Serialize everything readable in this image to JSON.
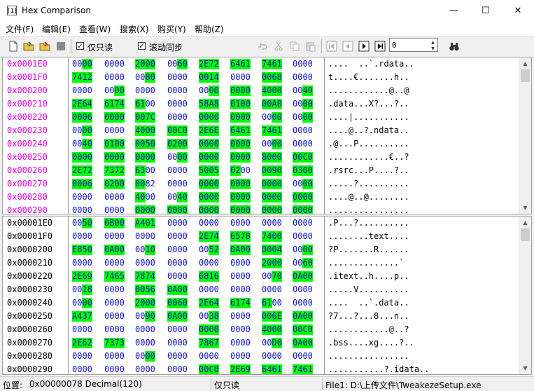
{
  "window": {
    "title": "Hex Comparison",
    "icon": "[1]",
    "minimize": "—",
    "maximize": "☐",
    "close": "✕"
  },
  "menu": [
    "文件(F)",
    "编辑(E)",
    "查看(W)",
    "搜索(X)",
    "购买(Y)",
    "帮助(Z)"
  ],
  "toolbar": {
    "readonly_label": "仅只读",
    "sync_scroll_label": "滚动同步",
    "offset_value": "0",
    "readonly_checked": "✓",
    "sync_checked": "✓"
  },
  "pane1": {
    "addresses": [
      "0x0001E0",
      "0x0001F0",
      "0x000200",
      "0x000210",
      "0x000220",
      "0x000230",
      "0x000240",
      "0x000250",
      "0x000260",
      "0x000270",
      "0x000280",
      "0x000290"
    ],
    "hex": [
      [
        "0000",
        "0000",
        "2000",
        "0060",
        "2E72",
        "6461",
        "7461",
        "0000"
      ],
      [
        "7412",
        "0000",
        "0080",
        "0000",
        "0014",
        "0000",
        "0068",
        "0000"
      ],
      [
        "0000",
        "0000",
        "0000",
        "0000",
        "0000",
        "0000",
        "4000",
        "0040"
      ],
      [
        "2E64",
        "6174",
        "6100",
        "0000",
        "58A8",
        "0100",
        "00A0",
        "0000"
      ],
      [
        "0006",
        "0000",
        "007C",
        "0000",
        "0000",
        "0000",
        "0000",
        "0000"
      ],
      [
        "0000",
        "0000",
        "4000",
        "00C0",
        "2E6E",
        "6461",
        "7461",
        "0000"
      ],
      [
        "0040",
        "0100",
        "0050",
        "0200",
        "0000",
        "0000",
        "0000",
        "0000"
      ],
      [
        "0000",
        "0000",
        "0000",
        "0000",
        "0000",
        "0000",
        "8000",
        "00C0"
      ],
      [
        "2E72",
        "7372",
        "6300",
        "0000",
        "5005",
        "0200",
        "0090",
        "0300"
      ],
      [
        "0006",
        "0200",
        "0082",
        "0000",
        "0000",
        "0000",
        "0000",
        "0000"
      ],
      [
        "0000",
        "0000",
        "4000",
        "0040",
        "0000",
        "0000",
        "0000",
        "0000"
      ],
      [
        "0000",
        "0000",
        "0000",
        "0000",
        "0000",
        "0000",
        "0000",
        "0000"
      ]
    ],
    "ascii": [
      "....  ..`.rdata..",
      "t....€.......h..",
      "............@..@",
      ".data...X?...?..",
      "....|...........",
      "....@..?.ndata..",
      ".@...P..........",
      "............€..?",
      ".rsrc...P....?..",
      ".....?..........",
      "....@..@........",
      "................"
    ]
  },
  "pane2": {
    "addresses": [
      "0x00001E0",
      "0x00001F0",
      "0x0000200",
      "0x0000210",
      "0x0000220",
      "0x0000230",
      "0x0000240",
      "0x0000250",
      "0x0000260",
      "0x0000270",
      "0x0000280",
      "0x0000290"
    ],
    "hex": [
      [
        "0050",
        "0B00",
        "A401",
        "0000",
        "0000",
        "0000",
        "0000",
        "0000"
      ],
      [
        "0000",
        "0000",
        "0000",
        "0000",
        "2E74",
        "6578",
        "7400",
        "0000"
      ],
      [
        "E850",
        "0A00",
        "0010",
        "0000",
        "0052",
        "0A00",
        "0004",
        "0000"
      ],
      [
        "0000",
        "0000",
        "0000",
        "0000",
        "0000",
        "0000",
        "2000",
        "0060"
      ],
      [
        "2E69",
        "7465",
        "7874",
        "0000",
        "6816",
        "0000",
        "0070",
        "0A00"
      ],
      [
        "0018",
        "0000",
        "0056",
        "0A00",
        "0000",
        "0000",
        "0000",
        "0000"
      ],
      [
        "0000",
        "0000",
        "2000",
        "0060",
        "2E64",
        "6174",
        "6100",
        "0000"
      ],
      [
        "A437",
        "0000",
        "0090",
        "0A00",
        "0038",
        "0000",
        "006E",
        "0A00"
      ],
      [
        "0000",
        "0000",
        "0000",
        "0000",
        "0000",
        "0000",
        "4000",
        "00C0"
      ],
      [
        "2E62",
        "7373",
        "0000",
        "0000",
        "7867",
        "0000",
        "00D0",
        "0A00"
      ],
      [
        "0000",
        "0000",
        "0000",
        "0000",
        "0000",
        "0000",
        "0000",
        "0000"
      ],
      [
        "0000",
        "0000",
        "0000",
        "0000",
        "00C0",
        "2E69",
        "6461",
        "7461"
      ]
    ],
    "ascii": [
      ".P...?..........",
      "........text....",
      "?P.......R......",
      "..............`",
      ".itext..h....p..",
      ".....V..........",
      "....  ..`.data..",
      "?7...?...8...n..",
      "............@..?",
      ".bss....xg....?..",
      "................",
      "...........?.idata.."
    ]
  },
  "status": {
    "position_label": "位置:",
    "position_value": "0x00000078 Decimal(120)",
    "mode": "仅只读",
    "file": "File1: D:\\上传文件\\TweakezeSetup.exe"
  }
}
